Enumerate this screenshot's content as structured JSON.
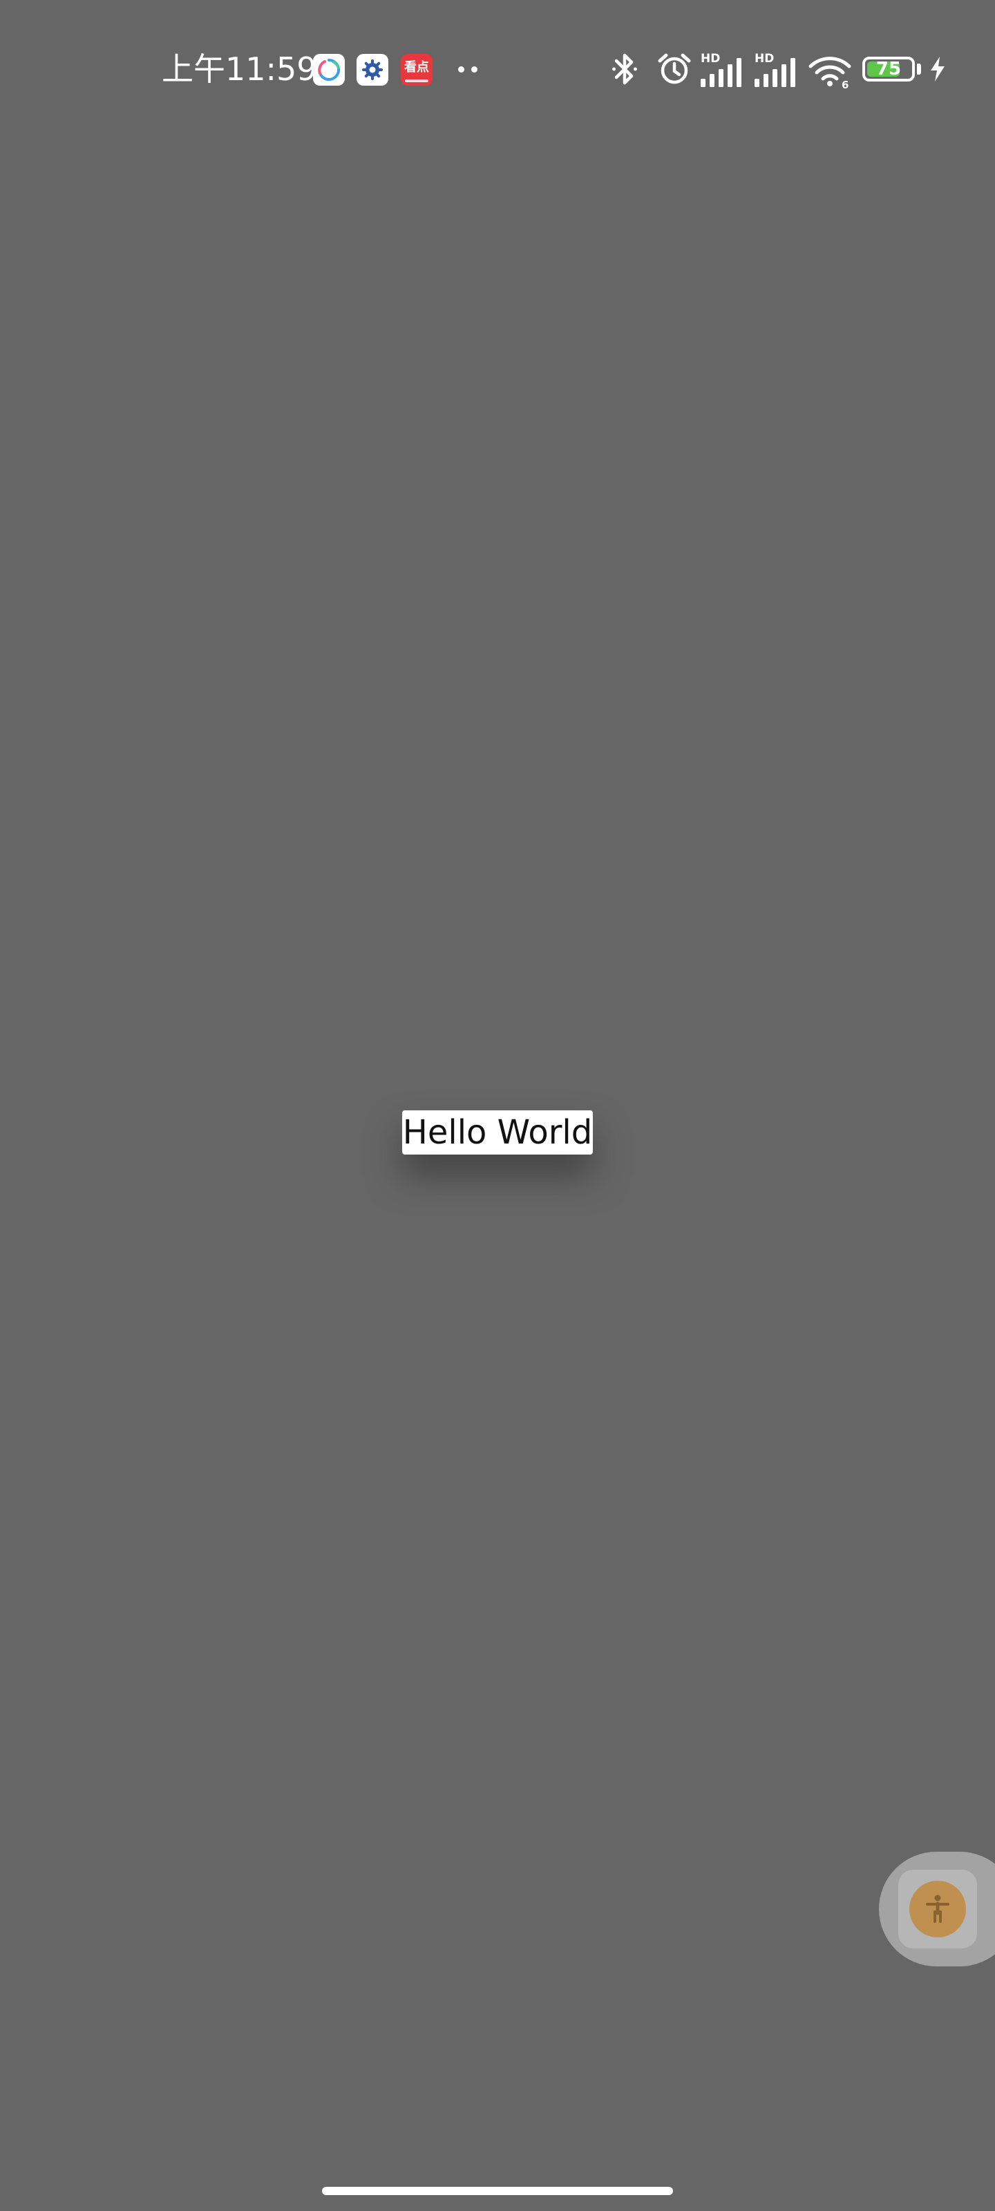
{
  "status_bar": {
    "time": "上午11:59",
    "notification_icons": [
      "sync-app-icon",
      "settings-app-icon",
      "news-app-icon"
    ],
    "news_app_glyph": "看点",
    "more_notifications_icon": "more-dots-icon",
    "system_icons": [
      "bluetooth-icon",
      "alarm-icon",
      "hd-signal-icon",
      "hd-signal-icon",
      "wifi-icon"
    ],
    "signal_label_1": "HD",
    "signal_label_2": "HD",
    "wifi_badge": "6",
    "battery_level": "75",
    "charging": true,
    "colors": {
      "battery_fill": "#5ec64a"
    }
  },
  "screen": {
    "label": "Hello World",
    "colors": {
      "background": "#666666",
      "label_background": "#ffffff",
      "label_text": "#111111"
    }
  },
  "floating_button": {
    "icon": "accessibility-icon",
    "colors": {
      "button": "#c09050"
    }
  },
  "navigation": {
    "home_indicator": "home-indicator"
  }
}
